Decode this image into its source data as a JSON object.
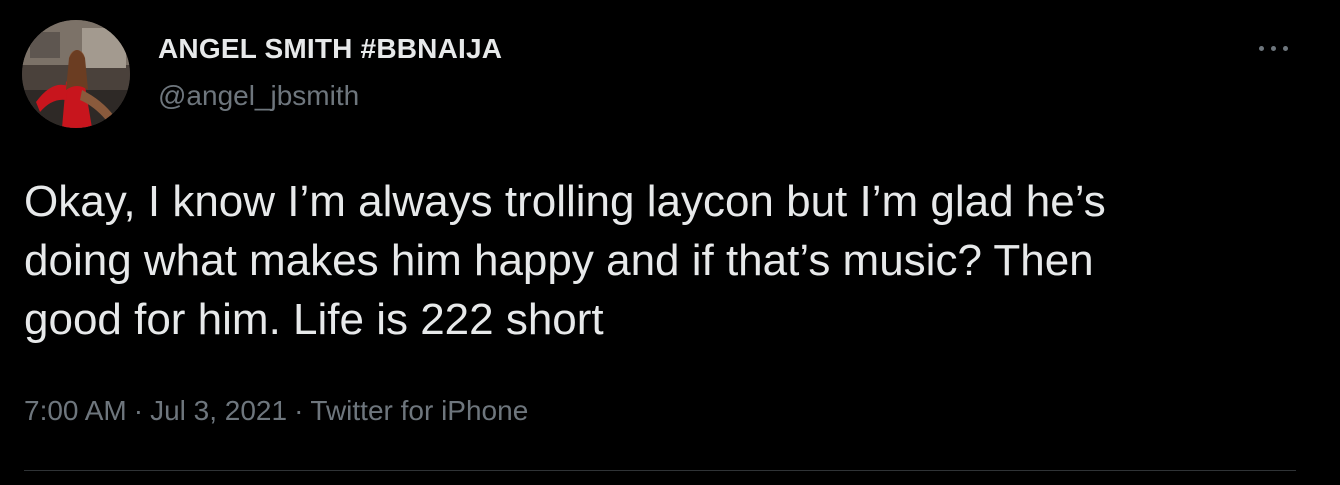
{
  "author": {
    "display_name": "ANGEL SMITH #BBNAIJA",
    "handle": "@angel_jbsmith",
    "avatar_icon": "user-avatar-photo"
  },
  "more_icon": "more-horizontal-icon",
  "tweet": {
    "text_lines": [
      "Okay, I know I’m always trolling laycon but I’m glad he’s",
      "doing what makes him happy and if that’s music? Then",
      "good for him. Life is 222 short"
    ]
  },
  "meta": {
    "time": "7:00 AM",
    "separator": "·",
    "date": "Jul 3, 2021",
    "source": "Twitter for iPhone"
  },
  "colors": {
    "background": "#000000",
    "primary_text": "#e7e9ea",
    "secondary_text": "#6e767d",
    "divider": "#2f3336"
  }
}
